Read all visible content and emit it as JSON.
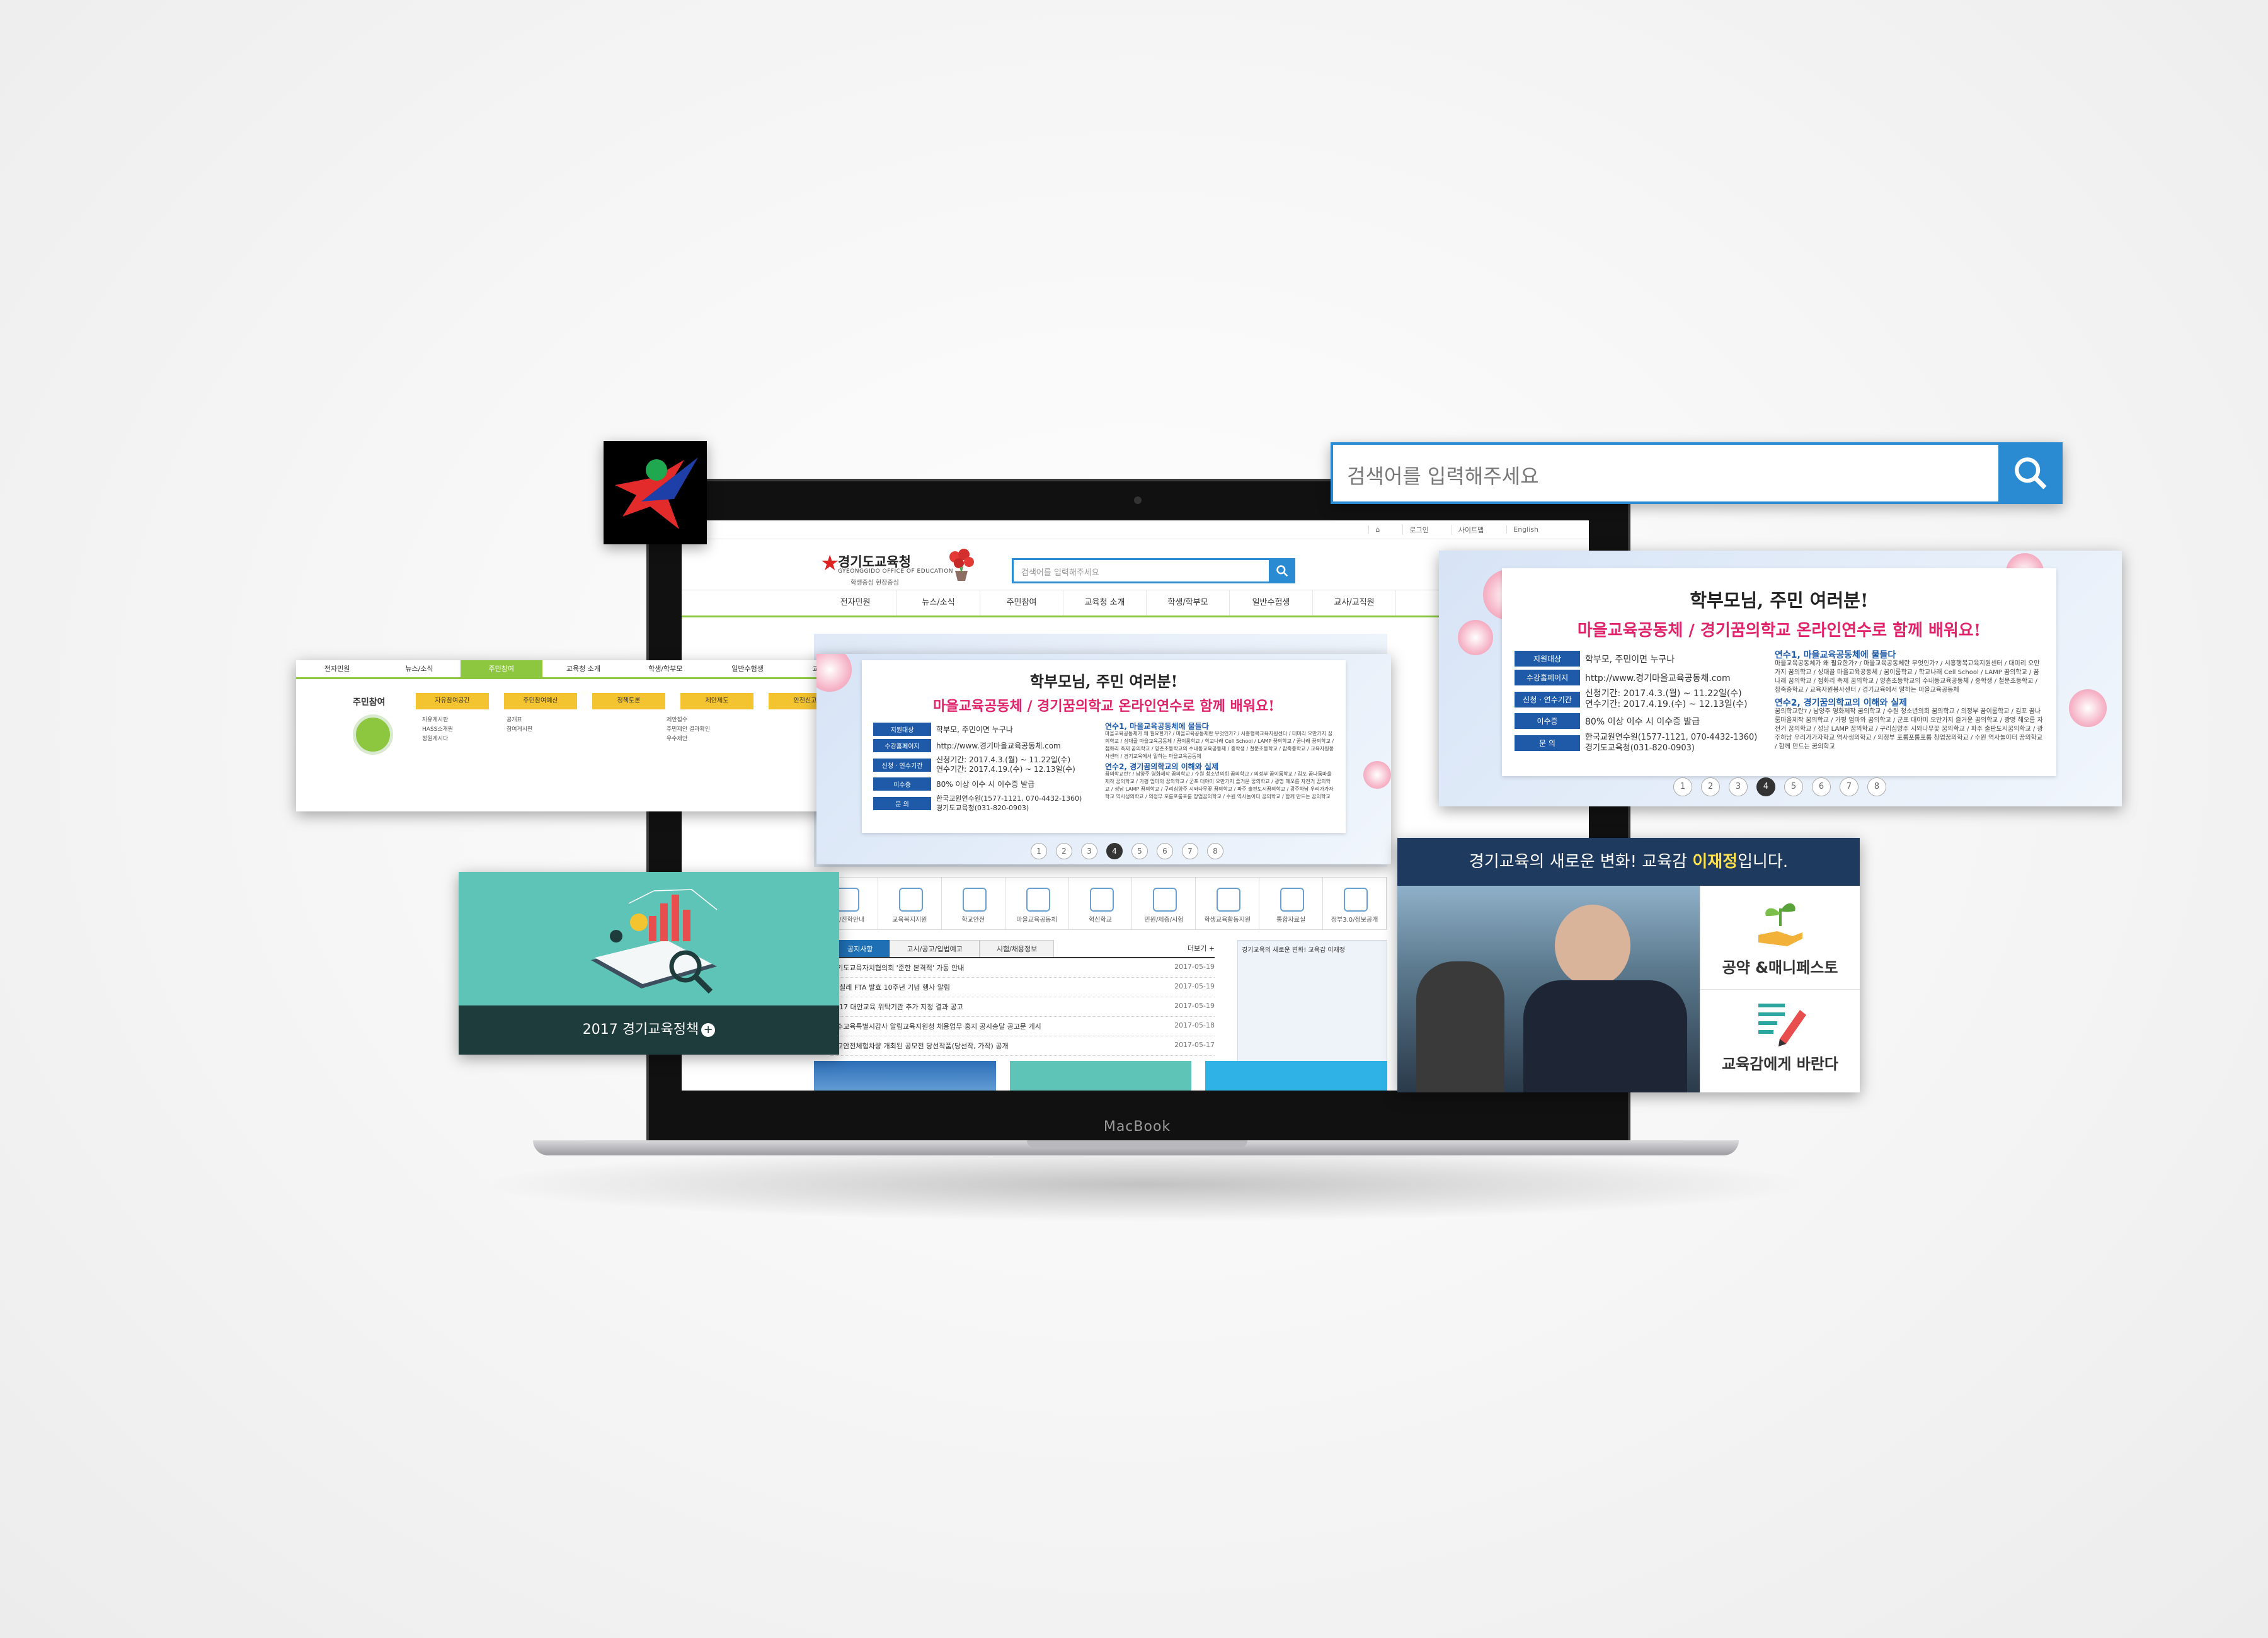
{
  "colors": {
    "accent": "#2b8bd2",
    "nav_green": "#8dc63f",
    "pink": "#e0226a",
    "navy": "#1e5aa8",
    "teal": "#5fc4b8"
  },
  "laptop": {
    "label": "MacBook"
  },
  "site": {
    "util_links": [
      "로그인",
      "사이트맵",
      "English"
    ],
    "logo": {
      "name": "경기도교육청",
      "sub": "GYEONGGIDO OFFICE OF EDUCATION",
      "slogan": "학생중심 현장중심"
    },
    "search_placeholder": "검색어를 입력해주세요",
    "nav": [
      "전자민원",
      "뉴스/소식",
      "주민참여",
      "교육청 소개",
      "학생/학부모",
      "일반수험생",
      "교사/교직원"
    ],
    "quick_icons": [
      "학생/진학안내",
      "교육복지지원",
      "학교안전",
      "마을교육공동체",
      "혁신학교",
      "민원/제증/시험",
      "학생교육활동지원",
      "통합자료실",
      "정부3.0/정보공개"
    ],
    "board": {
      "tabs": [
        "공지사항",
        "고시/공고/입법예고",
        "시험/채용정보"
      ],
      "more": "더보기",
      "rows": [
        {
          "title": "경기도교육자치협의회 '준한 본격적' 가동 안내",
          "date": "2017-05-19"
        },
        {
          "title": "한-칠레 FTA 발효 10주년 기념 행사 알림",
          "date": "2017-05-19"
        },
        {
          "title": "2017 대안교육 위탁기관 추가 지정 결과 공고",
          "date": "2017-05-19"
        },
        {
          "title": "특수교육특별시감사 알림교육지원청 채용업무 홍지 공시송달 공고문 게시",
          "date": "2017-05-18"
        },
        {
          "title": "학교안전체험차량 개최된 공모전 당선작품(당선작, 가작) 공개",
          "date": "2017-05-17"
        }
      ]
    },
    "side_news_title": "경기교육의 새로운 변화! 교육감 이재정"
  },
  "search_overlay": {
    "placeholder": "검색어를 입력해주세요"
  },
  "nav_overlay": {
    "tabs": [
      "전자민원",
      "뉴스/소식",
      "주민참여",
      "교육청 소개",
      "학생/학부모",
      "일반수험생",
      "교사/교직원"
    ],
    "active": "주민참여",
    "title": "주민참여",
    "pills": [
      "자유참여공간",
      "주민참여예산",
      "정책토론",
      "제안제도",
      "안전신고"
    ],
    "col1": [
      "자유게시판",
      "HASS소개원",
      "정원게시다"
    ],
    "col2": [
      "공개표",
      "참여게시판"
    ],
    "col3": [
      "제안접수",
      "주민제안 결과확인",
      "우수제안"
    ]
  },
  "slide": {
    "title": "학부모님, 주민 여러분!",
    "subtitle": "마을교육공동체 / 경기꿈의학교 온라인연수로 함께 배워요!",
    "rows": [
      {
        "tag": "지원대상",
        "text": "학부모, 주민이면 누구나"
      },
      {
        "tag": "수강홈페이지",
        "text": "http://www.경기마을교육공동체.com"
      },
      {
        "tag": "신청 · 연수기간",
        "text": "신청기간: 2017.4.3.(월) ~ 11.22일(수)",
        "text2": "연수기간: 2017.4.19.(수) ~ 12.13일(수)"
      },
      {
        "tag": "이수증",
        "text": "80% 이상 이수 시 이수증 발급"
      },
      {
        "tag": "문 의",
        "text": "한국교원연수원(1577-1121, 070-4432-1360)",
        "text2": "경기도교육청(031-820-0903)"
      }
    ],
    "sec1_title": "연수1, 마을교육공동체에 물들다",
    "sec1_text": "마을교육공동체가 왜 필요한가? / 마을교육공동체란 무엇인가? / 시흥행복교육지원센터 / 대미리 오만가지 꿈의학교 / 성대골 마을교육공동체 / 꿈이룸학교 / 학교나래 Cell School / LAMP 꿈의학교 / 꿈나래 꿈의학교 / 점화리 축제 꿈의학교 / 양촌초등학교의 수내동교육공동체 / 중학생 / 철문초등학교 / 참죽중학교 / 교육자원봉사센터 / 경기교육에서 말하는 마을교육공동체",
    "sec2_title": "연수2, 경기꿈의학교의 이해와 실제",
    "sec2_text": "꿈의학교란? / 남양주 영화제작 꿈의학교 / 수원 청소년의회 꿈의학교 / 의정부 꿈이룸학교 / 김포 꿈나룸마을제작 꿈의학교 / 가평 엄마와 꿈의학교 / 군포 대야미 오만가지 즐거운 꿈의학교 / 광명 해오름 자전거 꿈의학교 / 성남 LAMP 꿈의학교 / 구리심양주 시와나무꽃 꿈의학교 / 파주 출판도시꿈의학교 / 광주하남 우리가가자학교 역사생의학교 / 의정부 포룸포룸포룸 창업꿈의학교 / 수원 역사놀이터 꿈의학교 / 함께 만드는 꿈의학교",
    "pages": [
      "1",
      "2",
      "3",
      "4",
      "5",
      "6",
      "7",
      "8"
    ],
    "active_page": "4"
  },
  "policy": {
    "label": "2017 경기교육정책"
  },
  "superintendent": {
    "head_prefix": "경기교육의 새로운 변화! 교육감 ",
    "head_name": "이재정",
    "head_suffix": "입니다.",
    "btn1": "공약 &매니페스토",
    "btn2": "교육감에게 바란다"
  }
}
